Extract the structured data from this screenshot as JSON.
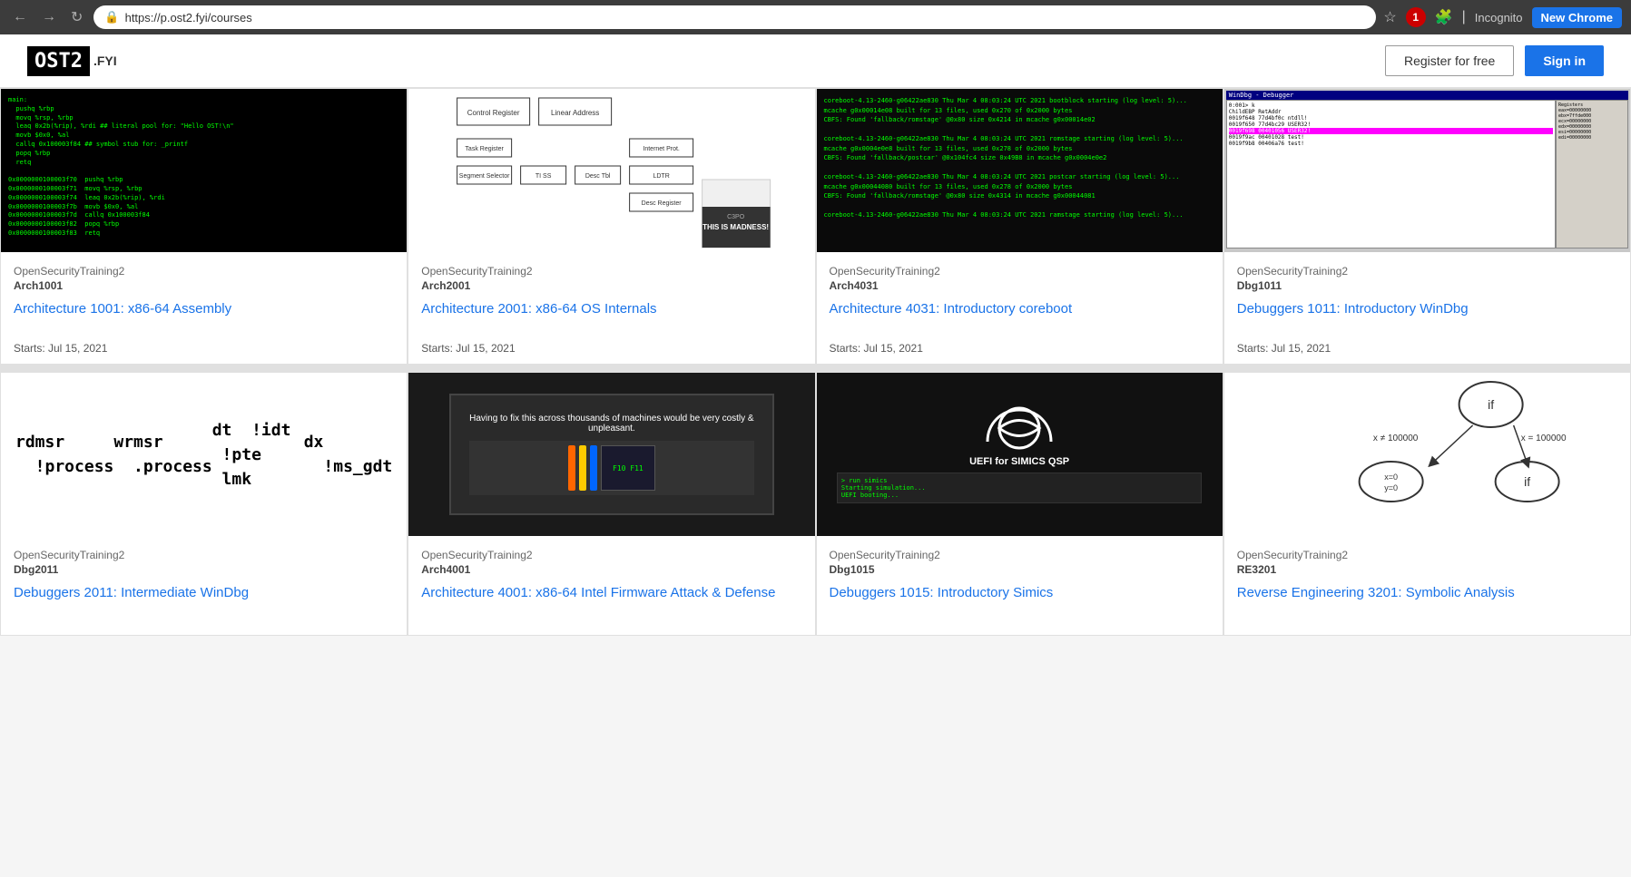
{
  "browser": {
    "url": "https://p.ost2.fyi/courses",
    "new_tab_label": "New Chrome",
    "incognito_label": "Incognito",
    "back_tooltip": "Back",
    "refresh_tooltip": "Refresh"
  },
  "header": {
    "logo_text": "OST2",
    "logo_sub": ".FYI",
    "register_label": "Register for free",
    "signin_label": "Sign in"
  },
  "courses": [
    {
      "org": "OpenSecurityTraining2",
      "code": "Arch1001",
      "title": "Architecture 1001: x86-64 Assembly",
      "date": "Starts: Jul 15, 2021",
      "thumb_type": "code"
    },
    {
      "org": "OpenSecurityTraining2",
      "code": "Arch2001",
      "title": "Architecture 2001: x86-64 OS Internals",
      "date": "Starts: Jul 15, 2021",
      "thumb_type": "diagram"
    },
    {
      "org": "OpenSecurityTraining2",
      "code": "Arch4031",
      "title": "Architecture 4031: Introductory coreboot",
      "date": "Starts: Jul 15, 2021",
      "thumb_type": "terminal"
    },
    {
      "org": "OpenSecurityTraining2",
      "code": "Dbg1011",
      "title": "Debuggers 1011: Introductory WinDbg",
      "date": "Starts: Jul 15, 2021",
      "thumb_type": "windbg"
    },
    {
      "org": "OpenSecurityTraining2",
      "code": "Dbg2011",
      "title": "Debuggers 2011: Intermediate WinDbg",
      "date": "",
      "thumb_type": "cmds"
    },
    {
      "org": "OpenSecurityTraining2",
      "code": "Arch4001",
      "title": "Architecture 4001: x86-64 Intel Firmware Attack & Defense",
      "date": "",
      "thumb_type": "hardware"
    },
    {
      "org": "OpenSecurityTraining2",
      "code": "Dbg1015",
      "title": "Debuggers 1015: Introductory Simics",
      "date": "",
      "thumb_type": "uefi"
    },
    {
      "org": "OpenSecurityTraining2",
      "code": "RE3201",
      "title": "Reverse Engineering 3201: Symbolic Analysis",
      "date": "",
      "thumb_type": "graph"
    }
  ]
}
